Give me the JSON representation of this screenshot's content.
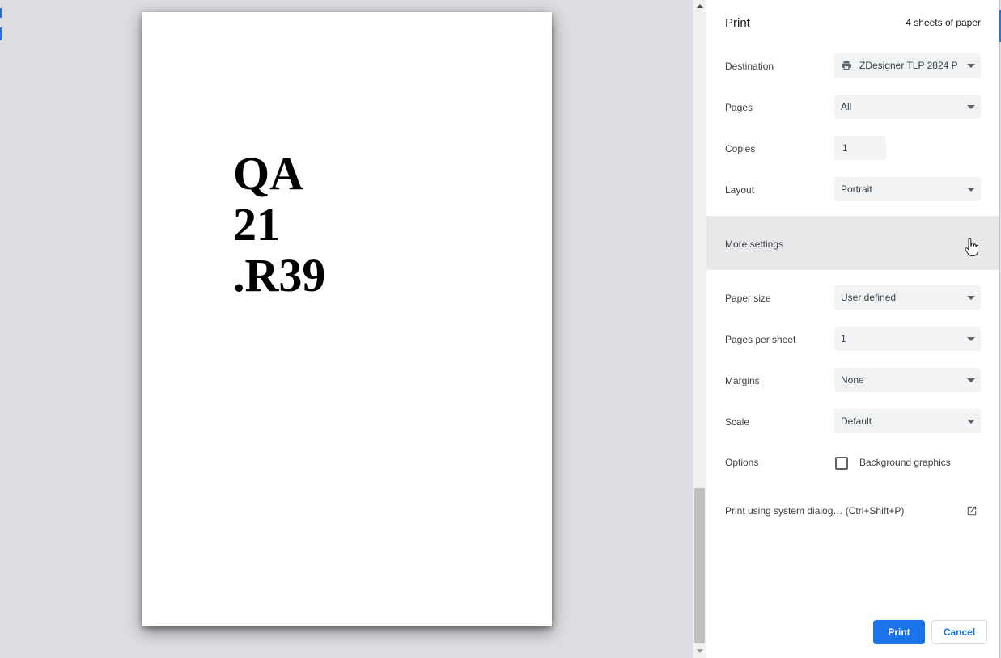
{
  "preview": {
    "page_lines": [
      "QA",
      "21",
      ".R39"
    ]
  },
  "sidebar": {
    "title": "Print",
    "sheet_count": "4 sheets of paper",
    "destination": {
      "label": "Destination",
      "value": "ZDesigner TLP 2824 P",
      "icon": "printer-icon"
    },
    "pages": {
      "label": "Pages",
      "value": "All"
    },
    "copies": {
      "label": "Copies",
      "value": "1"
    },
    "layout": {
      "label": "Layout",
      "value": "Portrait"
    },
    "more_settings": {
      "label": "More settings"
    },
    "paper_size": {
      "label": "Paper size",
      "value": "User defined"
    },
    "pages_per_sheet": {
      "label": "Pages per sheet",
      "value": "1"
    },
    "margins": {
      "label": "Margins",
      "value": "None"
    },
    "scale": {
      "label": "Scale",
      "value": "Default"
    },
    "options": {
      "label": "Options",
      "checkbox_label": "Background graphics",
      "checked": false
    },
    "system_dialog": {
      "label": "Print using system dialog… (Ctrl+Shift+P)",
      "icon": "open-in-new-icon"
    },
    "buttons": {
      "print": "Print",
      "cancel": "Cancel"
    }
  },
  "colors": {
    "accent": "#1a73e8",
    "preview_bg": "#dcdce2",
    "select_bg": "#f1f3f4",
    "more_settings_bg": "#e8e7ea"
  }
}
